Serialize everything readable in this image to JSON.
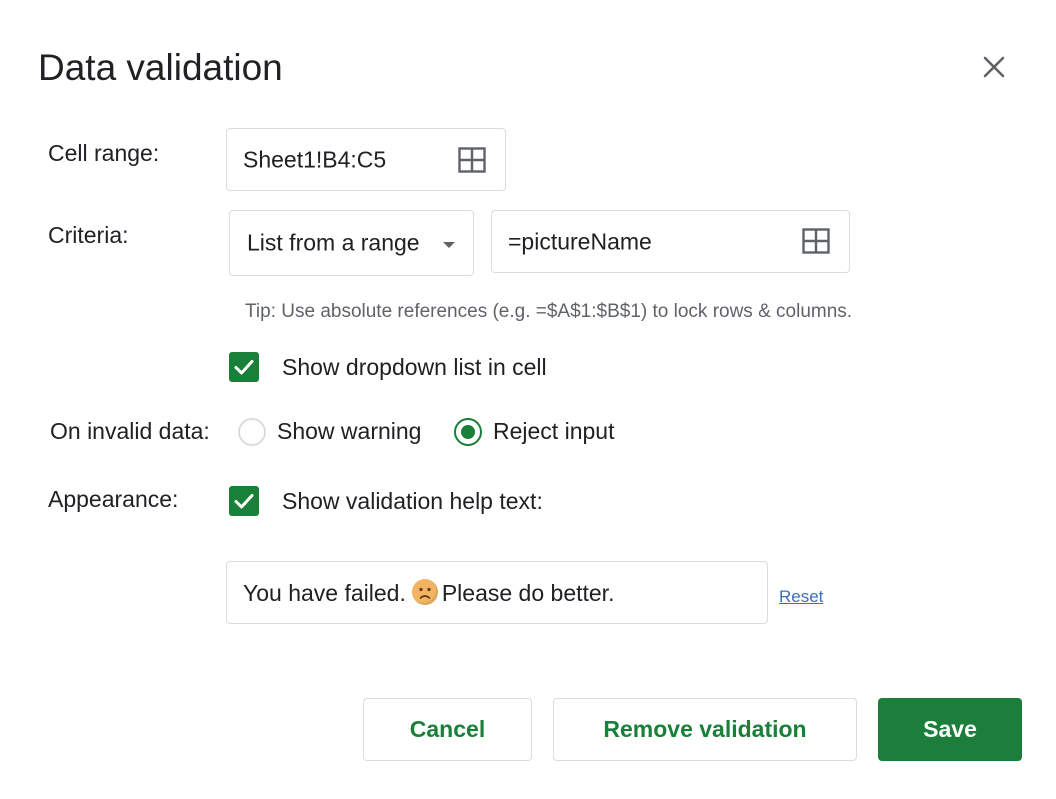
{
  "dialog": {
    "title": "Data validation",
    "close_icon": "close-icon"
  },
  "cell_range": {
    "label": "Cell range:",
    "value": "Sheet1!B4:C5",
    "icon": "grid-select-icon"
  },
  "criteria": {
    "label": "Criteria:",
    "type_selected": "List from a range",
    "range_value": "=pictureName",
    "icon": "grid-select-icon",
    "tip": "Tip: Use absolute references (e.g. =$A$1:$B$1) to lock rows & columns."
  },
  "dropdown_option": {
    "label": "Show dropdown list in cell",
    "checked": true
  },
  "invalid_data": {
    "label": "On invalid data:",
    "options": [
      {
        "label": "Show warning",
        "selected": false
      },
      {
        "label": "Reject input",
        "selected": true
      }
    ]
  },
  "appearance": {
    "label": "Appearance:",
    "help_text_label": "Show validation help text:",
    "help_text_checked": true,
    "help_text_before": "You have failed.",
    "help_text_emoji": "disappointed-face-icon",
    "help_text_after": "Please do better.",
    "reset_label": "Reset"
  },
  "footer": {
    "cancel_label": "Cancel",
    "remove_label": "Remove validation",
    "save_label": "Save"
  },
  "colors": {
    "accent": "#188038",
    "border": "#dadce0",
    "tip": "#5f6368",
    "link": "#3c6fb6"
  }
}
